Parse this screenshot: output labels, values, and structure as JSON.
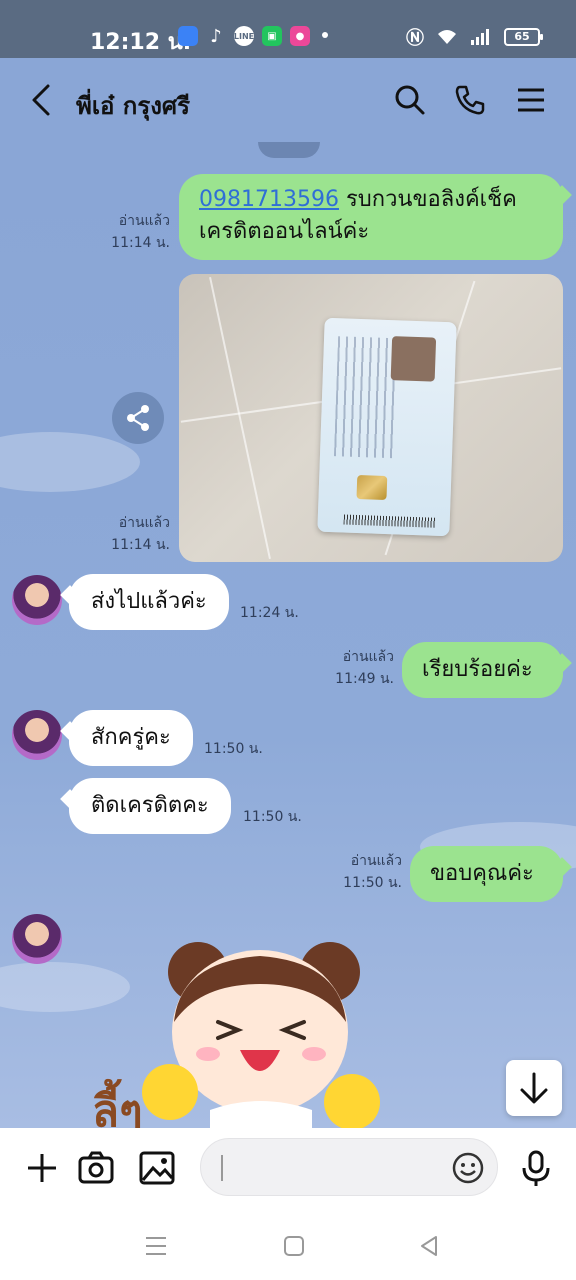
{
  "status_bar": {
    "time": "12:12 น.",
    "battery": "65",
    "app_icons": [
      "photos-icon",
      "tiktok-icon",
      "line-icon",
      "wallet-icon",
      "chat-app-icon"
    ]
  },
  "header": {
    "contact_name": "พี่เอ๋ กรุงศรี"
  },
  "messages": [
    {
      "side": "me",
      "phone": "0981713596",
      "text": " รบกวนขอลิงค์เช็คเครดิตออนไลน์ค่ะ",
      "read": "อ่านแล้ว",
      "time": "11:14 น."
    },
    {
      "side": "me",
      "type": "image",
      "image_desc": "Thai National ID Card",
      "read": "อ่านแล้ว",
      "time": "11:14 น."
    },
    {
      "side": "them",
      "text": "ส่งไปแล้วค่ะ",
      "time": "11:24 น."
    },
    {
      "side": "me",
      "text": "เรียบร้อยค่ะ",
      "read": "อ่านแล้ว",
      "time": "11:49 น."
    },
    {
      "side": "them",
      "text": "สักครู่คะ",
      "time": "11:50 น."
    },
    {
      "side": "them",
      "text": "ติดเครดิตคะ",
      "time": "11:50 น."
    },
    {
      "side": "me",
      "text": "ขอบคุณค่ะ",
      "read": "อ่านแล้ว",
      "time": "11:50 น."
    }
  ],
  "id_card": {
    "header": "บัตรประจำตัวประชาชน Thai National ID Card"
  },
  "sticker": {
    "caption": "ลี้ๆ"
  },
  "input": {
    "placeholder": ""
  },
  "colors": {
    "my_bubble": "#9be38f",
    "their_bubble": "#ffffff",
    "chat_background": "#8aa6d6",
    "link": "#2f6fd6"
  }
}
